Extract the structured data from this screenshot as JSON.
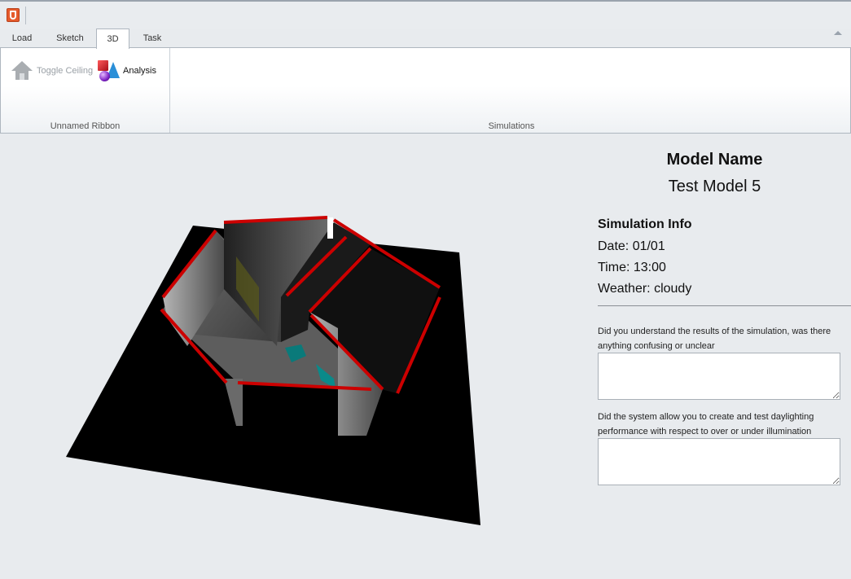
{
  "window": {
    "app_icon": "html5-icon"
  },
  "tabs": [
    {
      "label": "Load",
      "active": false
    },
    {
      "label": "Sketch",
      "active": false
    },
    {
      "label": "3D",
      "active": true
    },
    {
      "label": "Task",
      "active": false
    }
  ],
  "ribbon": {
    "groups": [
      {
        "label": "Unnamed Ribbon",
        "buttons": [
          {
            "label": "Toggle Ceiling",
            "icon": "house-icon",
            "enabled": false
          },
          {
            "label": "Analysis",
            "icon": "analysis-shapes-icon",
            "enabled": true
          }
        ]
      },
      {
        "label": "Simulations",
        "buttons": []
      }
    ]
  },
  "model": {
    "heading": "Model Name",
    "name": "Test Model 5"
  },
  "simulation": {
    "heading": "Simulation Info",
    "date": "Date: 01/01",
    "time": "Time: 13:00",
    "weather": "Weather: cloudy"
  },
  "feedback": {
    "q1": "Did you understand the results of the simulation, was there anything confusing or unclear",
    "q1_value": "",
    "q2": "Did the system allow you to create and test daylighting performance with respect to over or under illumination",
    "q2_value": ""
  },
  "colors": {
    "accent_wall_edge": "#cc0000",
    "ground": "#000000",
    "background": "#e8ebee"
  }
}
